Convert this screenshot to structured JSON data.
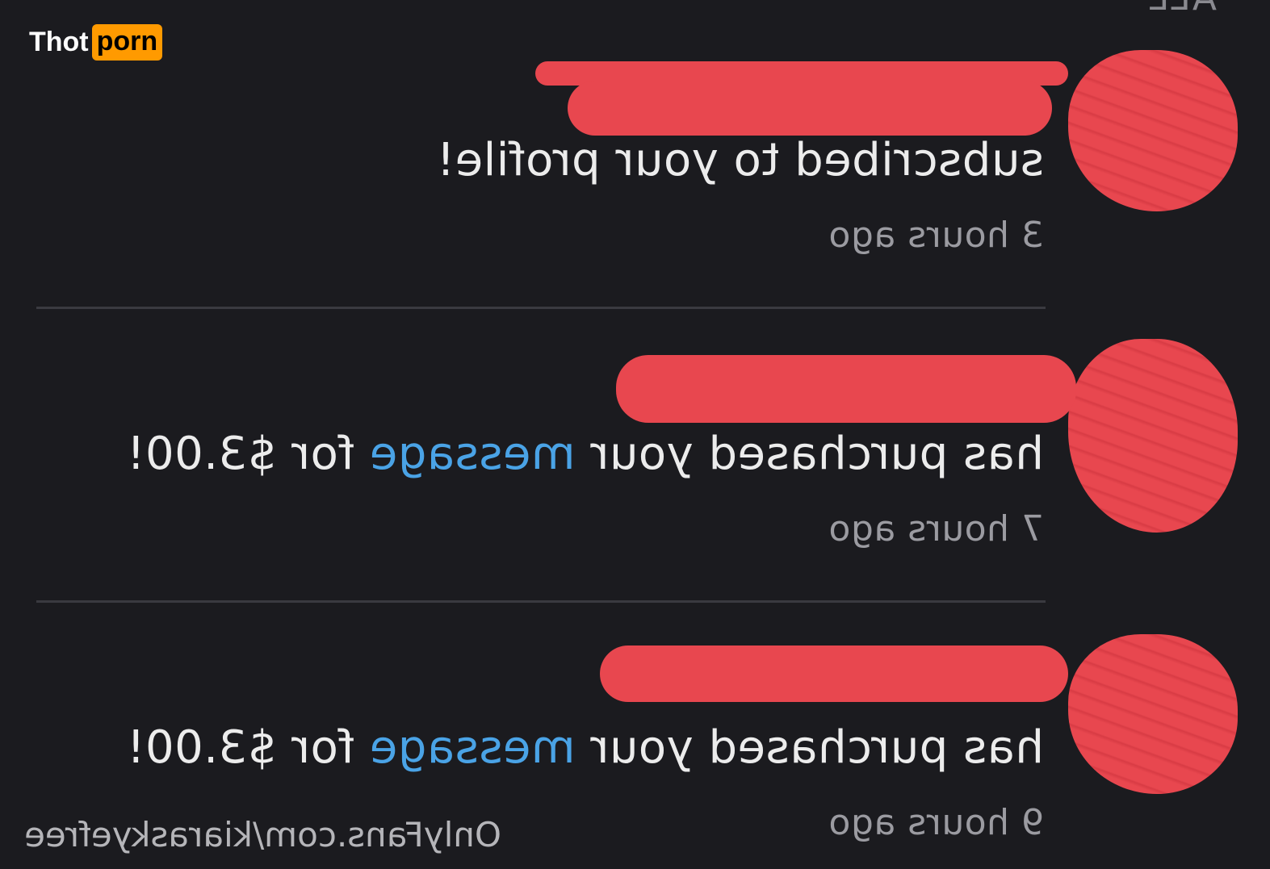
{
  "header": {
    "label": "ALL"
  },
  "notifications": [
    {
      "message_prefix": "subscribed to your profile!",
      "message_link": "",
      "message_suffix": "",
      "time": "3 hours ago"
    },
    {
      "message_prefix": "has purchased your ",
      "message_link": "message",
      "message_suffix": " for $3.00!",
      "time": "7 hours ago"
    },
    {
      "message_prefix": "has purchased your ",
      "message_link": "message",
      "message_suffix": " for $3.00!",
      "time": "9 hours ago"
    }
  ],
  "watermark": {
    "url_text": "OnlyFans.com/kiaraskyefree"
  },
  "logo": {
    "part1": "Thot",
    "part2": "porn"
  },
  "colors": {
    "background": "#1b1b1f",
    "link": "#4aa3e6",
    "redaction": "#e8474f",
    "logo_accent": "#ff9a00"
  }
}
